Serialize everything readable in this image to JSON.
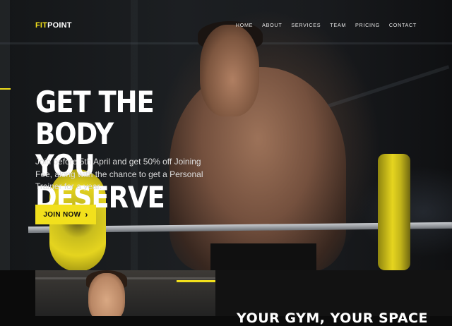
{
  "brand": {
    "logo_part1": "FIT",
    "logo_part2": "POINT",
    "accent": "#f2e01c"
  },
  "nav": {
    "items": [
      "HOME",
      "ABOUT",
      "SERVICES",
      "TEAM",
      "PRICING",
      "CONTACT"
    ]
  },
  "hero": {
    "headline_line1": "GET THE BODY",
    "headline_line2": "YOU DESERVE",
    "subtext": "Join before 5th April and get 50% off Joining Fee, along with the chance to get a Personal Trainer for a year.",
    "cta_label": "JOIN NOW",
    "cta_icon": "chevron-right-icon"
  },
  "next_section": {
    "title": "YOUR GYM, YOUR SPACE"
  }
}
